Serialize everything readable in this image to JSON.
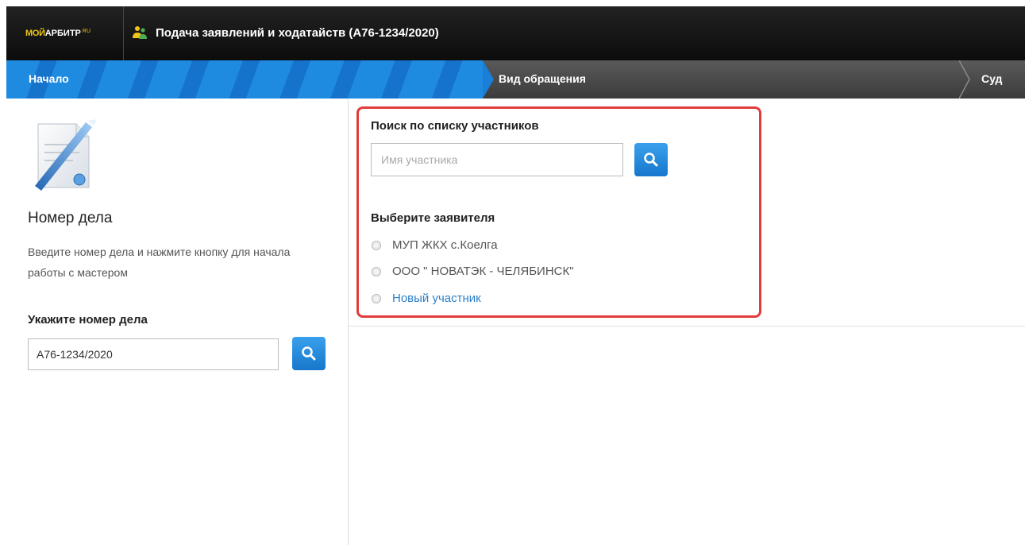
{
  "header": {
    "logo": {
      "part1": "МОЙ",
      "part2": "АРБИТР",
      "part3": "RU"
    },
    "title": "Подача заявлений и ходатайств  (А76-1234/2020)"
  },
  "wizard": {
    "steps": [
      {
        "label": "Начало",
        "active": true
      },
      {
        "label": "Вид обращения",
        "active": false
      },
      {
        "label": "Суд",
        "active": false
      }
    ]
  },
  "case": {
    "heading": "Номер дела",
    "description": "Введите номер дела и нажмите кнопку для начала работы с мастером",
    "input_label": "Укажите номер дела",
    "input_value": "А76-1234/2020"
  },
  "participants": {
    "search_title": "Поиск по списку участников",
    "search_placeholder": "Имя участника",
    "applicant_title": "Выберите заявителя",
    "options": [
      {
        "label": "МУП ЖКХ с.Коелга",
        "is_link": false
      },
      {
        "label": "ООО \" НОВАТЭК - ЧЕЛЯБИНСК\"",
        "is_link": false
      },
      {
        "label": "Новый участник",
        "is_link": true
      }
    ]
  },
  "colors": {
    "accent_blue": "#1f8be0",
    "highlight_red": "#e23b3b",
    "link_blue": "#2a7fc9",
    "logo_yellow": "#f0c419"
  },
  "icons": {
    "app": "people-icon",
    "search": "magnifier-icon",
    "document": "document-pen-icon"
  }
}
